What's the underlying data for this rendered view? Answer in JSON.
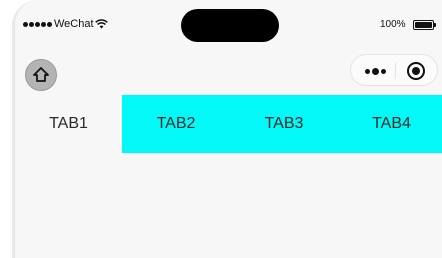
{
  "statusbar": {
    "carrier": "WeChat",
    "battery_percent": "100%",
    "battery_level": 1.0
  },
  "navbar": {
    "home_icon": "home-icon",
    "more_icon": "more-dots-icon",
    "close_icon": "target-circle-icon"
  },
  "tabs": [
    {
      "label": "TAB1"
    },
    {
      "label": "TAB2"
    },
    {
      "label": "TAB3"
    },
    {
      "label": "TAB4"
    }
  ],
  "colors": {
    "tab_active_background": "#03f8f8",
    "page_background": "#f7f7f7"
  }
}
